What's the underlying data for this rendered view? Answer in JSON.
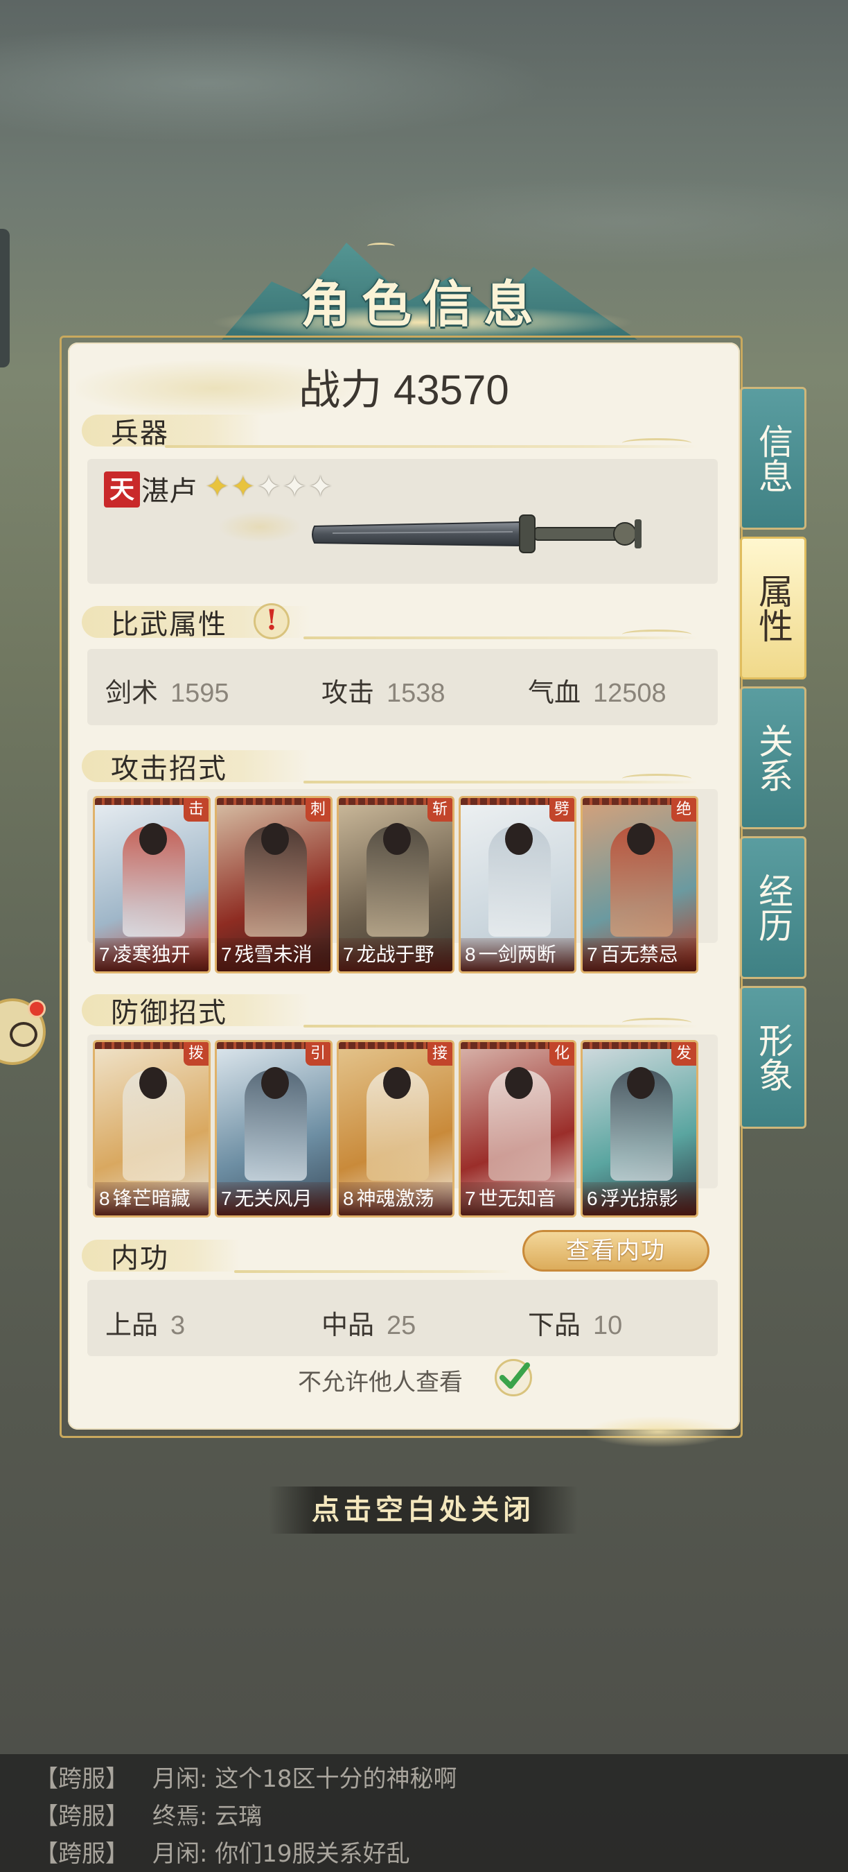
{
  "title": "角色信息",
  "power": {
    "label": "战力",
    "value": "43570"
  },
  "weapon": {
    "section_title": "兵器",
    "grade": "天",
    "name": "湛卢",
    "stars_filled": 2,
    "stars_total": 5
  },
  "combat_attrs": {
    "section_title": "比武属性",
    "stats": [
      {
        "label": "剑术",
        "value": "1595"
      },
      {
        "label": "攻击",
        "value": "1538"
      },
      {
        "label": "气血",
        "value": "12508"
      }
    ]
  },
  "attack_moves": {
    "section_title": "攻击招式",
    "cards": [
      {
        "level": "7",
        "name": "凌寒独开",
        "type": "击"
      },
      {
        "level": "7",
        "name": "残雪未消",
        "type": "刺"
      },
      {
        "level": "7",
        "name": "龙战于野",
        "type": "斩"
      },
      {
        "level": "8",
        "name": "一剑两断",
        "type": "劈"
      },
      {
        "level": "7",
        "name": "百无禁忌",
        "type": "绝"
      }
    ]
  },
  "defense_moves": {
    "section_title": "防御招式",
    "cards": [
      {
        "level": "8",
        "name": "锋芒暗藏",
        "type": "拨"
      },
      {
        "level": "7",
        "name": "无关风月",
        "type": "引"
      },
      {
        "level": "8",
        "name": "神魂激荡",
        "type": "接"
      },
      {
        "level": "7",
        "name": "世无知音",
        "type": "化"
      },
      {
        "level": "6",
        "name": "浮光掠影",
        "type": "发"
      }
    ]
  },
  "neigong": {
    "section_title": "内功",
    "button_label": "查看内功",
    "stats": [
      {
        "label": "上品",
        "value": "3"
      },
      {
        "label": "中品",
        "value": "25"
      },
      {
        "label": "下品",
        "value": "10"
      }
    ]
  },
  "privacy": {
    "label": "不允许他人查看",
    "checked": true
  },
  "tabs": [
    {
      "label": "信息",
      "active": false
    },
    {
      "label": "属性",
      "active": true
    },
    {
      "label": "关系",
      "active": false
    },
    {
      "label": "经历",
      "active": false
    },
    {
      "label": "形象",
      "active": false
    }
  ],
  "close_hint": "点击空白处关闭",
  "chat": [
    {
      "channel": "【跨服】",
      "text": "月闲: 这个18区十分的神秘啊"
    },
    {
      "channel": "【跨服】",
      "text": "终焉: 云璃"
    },
    {
      "channel": "【跨服】",
      "text": "月闲: 你们19服关系好乱"
    }
  ],
  "colors": {
    "panel_bg": "#f6f2e6",
    "tab_teal": "#4a8f92",
    "tab_active": "#f3dd92",
    "gold": "#c9a95e",
    "grade_red": "#c9292a"
  },
  "icons": [
    "alert-icon",
    "check-icon",
    "star-icon",
    "sword-image",
    "avatar-icon"
  ]
}
